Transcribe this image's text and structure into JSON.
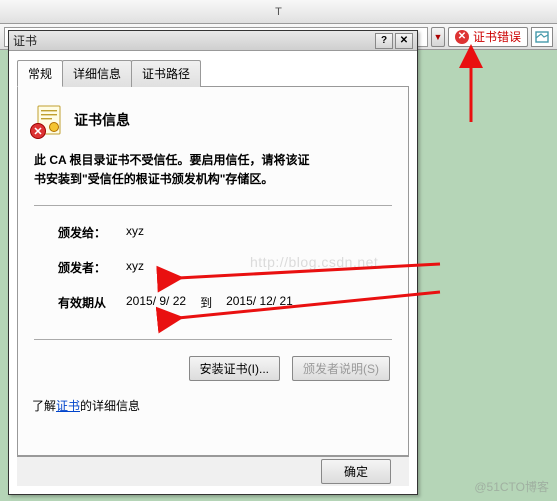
{
  "browser": {
    "t_mark": "T",
    "cert_error_label": "证书错误"
  },
  "dialog": {
    "title": "证书",
    "tabs": [
      "常规",
      "详细信息",
      "证书路径"
    ],
    "info_heading": "证书信息",
    "warning_line1": "此 CA 根目录证书不受信任。要启用信任，请将该证",
    "warning_line2": "书安装到\"受信任的根证书颁发机构\"存储区。",
    "issued_to_label": "颁发给：",
    "issued_to_value": "xyz",
    "issuer_label": "颁发者：",
    "issuer_value": "xyz",
    "validity_label": "有效期从",
    "validity_from": "2015/ 9/ 22",
    "validity_to_word": "到",
    "validity_to": "2015/ 12/ 21",
    "install_btn": "安装证书(I)...",
    "issuer_stmt_btn": "颁发者说明(S)",
    "more_info_prefix": "了解",
    "more_info_link": "证书",
    "more_info_suffix": "的详细信息",
    "ok_btn": "确定"
  },
  "watermarks": {
    "blog": "http://blog.csdn.net",
    "cto": "@51CTO博客"
  }
}
